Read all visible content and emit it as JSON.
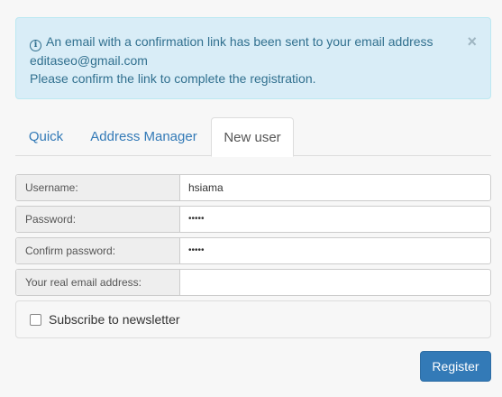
{
  "alert": {
    "line1": "An email with a confirmation link has been sent to your email address",
    "line2": "editaseo@gmail.com",
    "line3": "Please confirm the link to complete the registration.",
    "close_label": "×"
  },
  "tabs": [
    {
      "label": "Quick",
      "active": false
    },
    {
      "label": "Address Manager",
      "active": false
    },
    {
      "label": "New user",
      "active": true
    }
  ],
  "form": {
    "username": {
      "label": "Username:",
      "value": "hsiama"
    },
    "password": {
      "label": "Password:",
      "value": "•••••"
    },
    "confirm_password": {
      "label": "Confirm password:",
      "value": "•••••"
    },
    "email": {
      "label": "Your real email address:",
      "value": ""
    },
    "newsletter": {
      "label": "Subscribe to newsletter",
      "checked": false
    }
  },
  "register_label": "Register",
  "colors": {
    "alert_bg": "#d9edf7",
    "alert_text": "#31708f",
    "link": "#337ab7",
    "primary_button": "#337ab7"
  },
  "icons": {
    "alert": "info-circle-icon",
    "close": "close-icon"
  }
}
